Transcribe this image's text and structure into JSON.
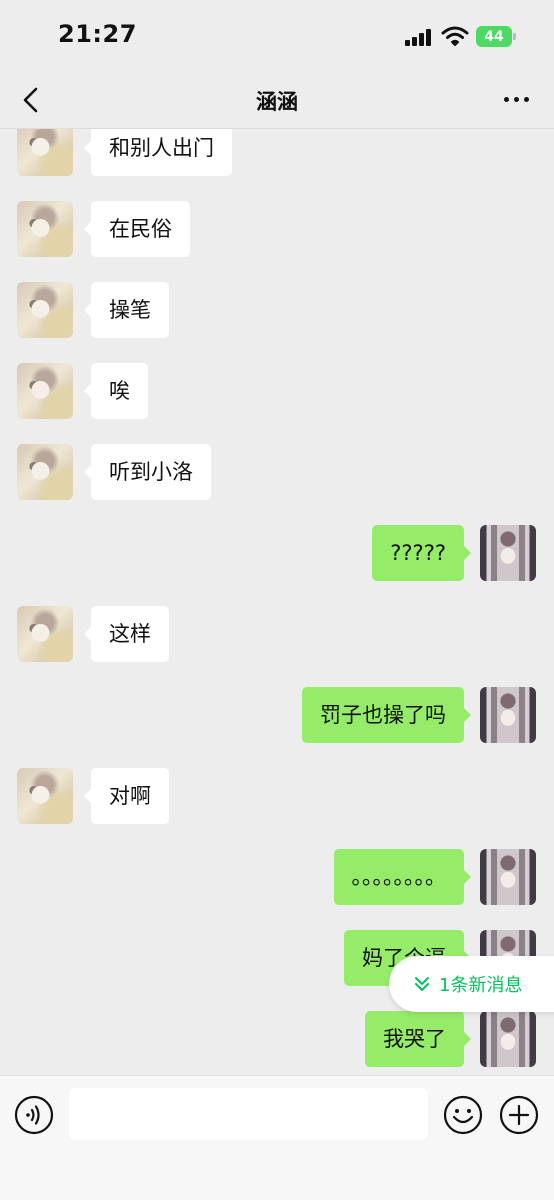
{
  "status_bar": {
    "time": "21:27",
    "battery": "44"
  },
  "nav": {
    "title": "涵涵",
    "back_icon": "chevron-left-icon",
    "more_icon": "more-dots-icon"
  },
  "messages": [
    {
      "side": "left",
      "text": "和别人出门"
    },
    {
      "side": "left",
      "text": "在民俗"
    },
    {
      "side": "left",
      "text": "操笔"
    },
    {
      "side": "left",
      "text": "唉"
    },
    {
      "side": "left",
      "text": "听到小洛"
    },
    {
      "side": "right",
      "text": "?????"
    },
    {
      "side": "left",
      "text": "这样"
    },
    {
      "side": "right",
      "text": "罚子也操了吗"
    },
    {
      "side": "left",
      "text": "对啊"
    },
    {
      "side": "right",
      "text": "。。。。。。。。"
    },
    {
      "side": "right",
      "text": "妈了个逼"
    },
    {
      "side": "right",
      "text": "我哭了"
    }
  ],
  "new_message_pill": {
    "label": "1条新消息",
    "icon": "double-chevron-down-icon",
    "color": "#07c160"
  },
  "input_bar": {
    "placeholder": "",
    "value": "",
    "voice_icon": "voice-icon",
    "emoji_icon": "emoji-icon",
    "plus_icon": "plus-icon"
  },
  "colors": {
    "background": "#ededed",
    "bubble_self": "#95ec69",
    "bubble_other": "#ffffff",
    "battery": "#4cd964"
  }
}
